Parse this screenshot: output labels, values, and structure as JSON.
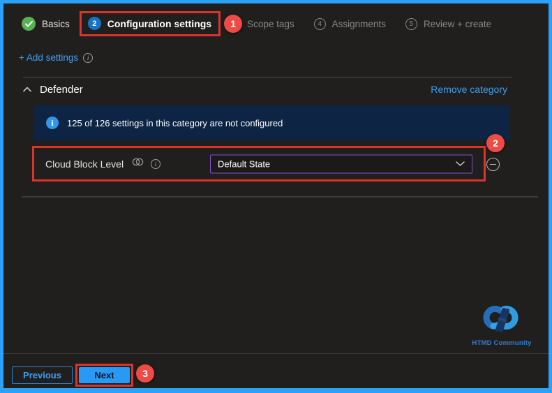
{
  "wizard": {
    "steps": [
      {
        "label": "Basics",
        "status": "complete"
      },
      {
        "label": "Configuration settings",
        "status": "current",
        "number": "2"
      },
      {
        "label": "Scope tags",
        "status": "upcoming"
      },
      {
        "label": "Assignments",
        "status": "upcoming",
        "number": "4"
      },
      {
        "label": "Review + create",
        "status": "upcoming",
        "number": "5"
      }
    ]
  },
  "toolbar": {
    "add_settings_label": "+ Add settings"
  },
  "category": {
    "name": "Defender",
    "remove_label": "Remove category",
    "info_message": "125 of 126 settings in this category are not configured",
    "info_icon_glyph": "i"
  },
  "setting": {
    "label": "Cloud Block Level",
    "value": "Default State"
  },
  "annotations": {
    "markers": [
      {
        "label": "1"
      },
      {
        "label": "2"
      },
      {
        "label": "3"
      }
    ]
  },
  "branding": {
    "name": "HTMD Community"
  },
  "footer": {
    "previous_label": "Previous",
    "next_label": "Next"
  },
  "colors": {
    "window_border": "#2ba1f8",
    "bg": "#201f1e",
    "accent_blue": "#3aa0f3",
    "annotation_red": "#d8352c",
    "annotation_circle": "#ef4a44",
    "success_green": "#57b257",
    "current_step_blue": "#1673c6",
    "banner_bg": "#0d2445",
    "dropdown_border": "#8a4fd0"
  }
}
